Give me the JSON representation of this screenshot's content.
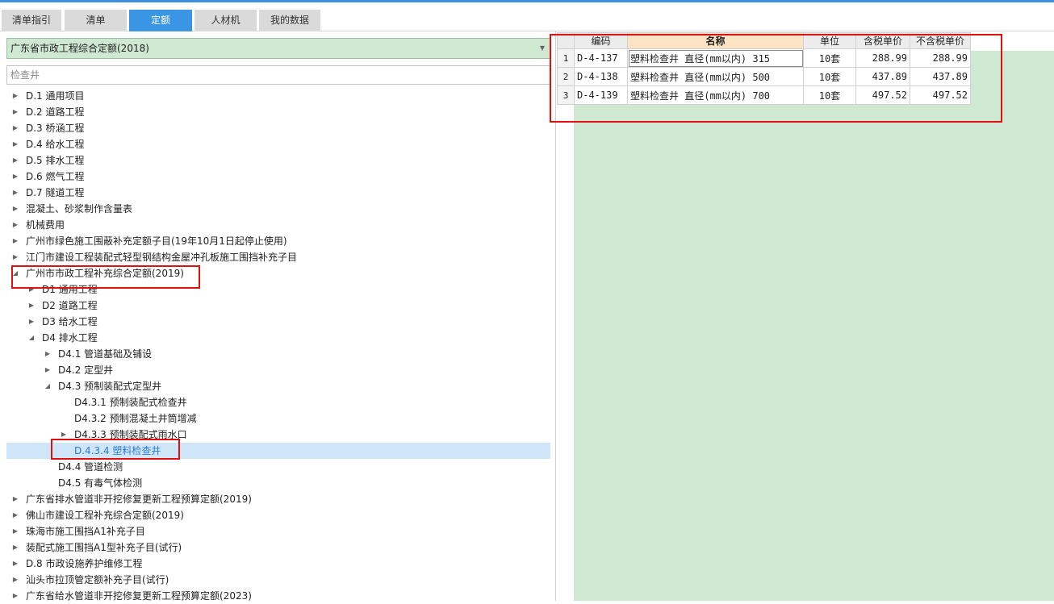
{
  "tabs": [
    {
      "label": "清单指引",
      "active": false
    },
    {
      "label": "清单",
      "active": false
    },
    {
      "label": "定额",
      "active": true
    },
    {
      "label": "人材机",
      "active": false
    },
    {
      "label": "我的数据",
      "active": false
    }
  ],
  "library": {
    "selected": "广东省市政工程综合定额(2018)"
  },
  "search": {
    "value": "检查井"
  },
  "tree": [
    {
      "label": "D.1 通用项目",
      "level": 0,
      "state": "collapsed"
    },
    {
      "label": "D.2 道路工程",
      "level": 0,
      "state": "collapsed"
    },
    {
      "label": "D.3 桥涵工程",
      "level": 0,
      "state": "collapsed"
    },
    {
      "label": "D.4 给水工程",
      "level": 0,
      "state": "collapsed"
    },
    {
      "label": "D.5 排水工程",
      "level": 0,
      "state": "collapsed"
    },
    {
      "label": "D.6 燃气工程",
      "level": 0,
      "state": "collapsed"
    },
    {
      "label": "D.7 隧道工程",
      "level": 0,
      "state": "collapsed"
    },
    {
      "label": "混凝土、砂浆制作含量表",
      "level": 0,
      "state": "collapsed"
    },
    {
      "label": "机械费用",
      "level": 0,
      "state": "collapsed"
    },
    {
      "label": "广州市绿色施工围蔽补充定额子目(19年10月1日起停止使用)",
      "level": 0,
      "state": "collapsed"
    },
    {
      "label": "江门市建设工程装配式轻型钢结构金屋冲孔板施工围挡补充子目",
      "level": 0,
      "state": "collapsed"
    },
    {
      "label": "广州市市政工程补充综合定额(2019)",
      "level": 0,
      "state": "expanded"
    },
    {
      "label": "D1 通用工程",
      "level": 1,
      "state": "collapsed"
    },
    {
      "label": "D2 道路工程",
      "level": 1,
      "state": "collapsed"
    },
    {
      "label": "D3 给水工程",
      "level": 1,
      "state": "collapsed"
    },
    {
      "label": "D4 排水工程",
      "level": 1,
      "state": "expanded"
    },
    {
      "label": "D4.1 管道基础及铺设",
      "level": 2,
      "state": "collapsed"
    },
    {
      "label": "D4.2 定型井",
      "level": 2,
      "state": "collapsed"
    },
    {
      "label": "D4.3 预制装配式定型井",
      "level": 2,
      "state": "expanded"
    },
    {
      "label": "D4.3.1 预制装配式检查井",
      "level": 3,
      "state": "leaf"
    },
    {
      "label": "D4.3.2 预制混凝土井筒增减",
      "level": 3,
      "state": "leaf"
    },
    {
      "label": "D4.3.3 预制装配式雨水口",
      "level": 3,
      "state": "collapsed"
    },
    {
      "label": "D.4.3.4 塑料检查井",
      "level": 3,
      "state": "leaf",
      "selected": true
    },
    {
      "label": "D4.4 管道检测",
      "level": 2,
      "state": "leaf"
    },
    {
      "label": "D4.5 有毒气体检测",
      "level": 2,
      "state": "leaf"
    },
    {
      "label": "广东省排水管道非开挖修复更新工程预算定额(2019)",
      "level": 0,
      "state": "collapsed"
    },
    {
      "label": "佛山市建设工程补充综合定额(2019)",
      "level": 0,
      "state": "collapsed"
    },
    {
      "label": "珠海市施工围挡A1补充子目",
      "level": 0,
      "state": "collapsed"
    },
    {
      "label": "装配式施工围挡A1型补充子目(试行)",
      "level": 0,
      "state": "collapsed"
    },
    {
      "label": "D.8 市政设施养护维修工程",
      "level": 0,
      "state": "collapsed"
    },
    {
      "label": "汕头市拉顶管定额补充子目(试行)",
      "level": 0,
      "state": "collapsed"
    },
    {
      "label": "广东省给水管道非开挖修复更新工程预算定额(2023)",
      "level": 0,
      "state": "collapsed"
    }
  ],
  "grid": {
    "headers": [
      "编码",
      "名称",
      "单位",
      "含税单价",
      "不含税单价"
    ],
    "rows": [
      {
        "no": "1",
        "code": "D-4-137",
        "name": "塑料检查井 直径(mm以内) 315",
        "unit": "10套",
        "tax_price": "288.99",
        "notax_price": "288.99"
      },
      {
        "no": "2",
        "code": "D-4-138",
        "name": "塑料检查井 直径(mm以内) 500",
        "unit": "10套",
        "tax_price": "437.89",
        "notax_price": "437.89"
      },
      {
        "no": "3",
        "code": "D-4-139",
        "name": "塑料检查井 直径(mm以内) 700",
        "unit": "10套",
        "tax_price": "497.52",
        "notax_price": "497.52"
      }
    ]
  },
  "colors": {
    "accent": "#3b95e5",
    "highlight_red": "#e01010",
    "panel_green": "#cfe8d2"
  }
}
